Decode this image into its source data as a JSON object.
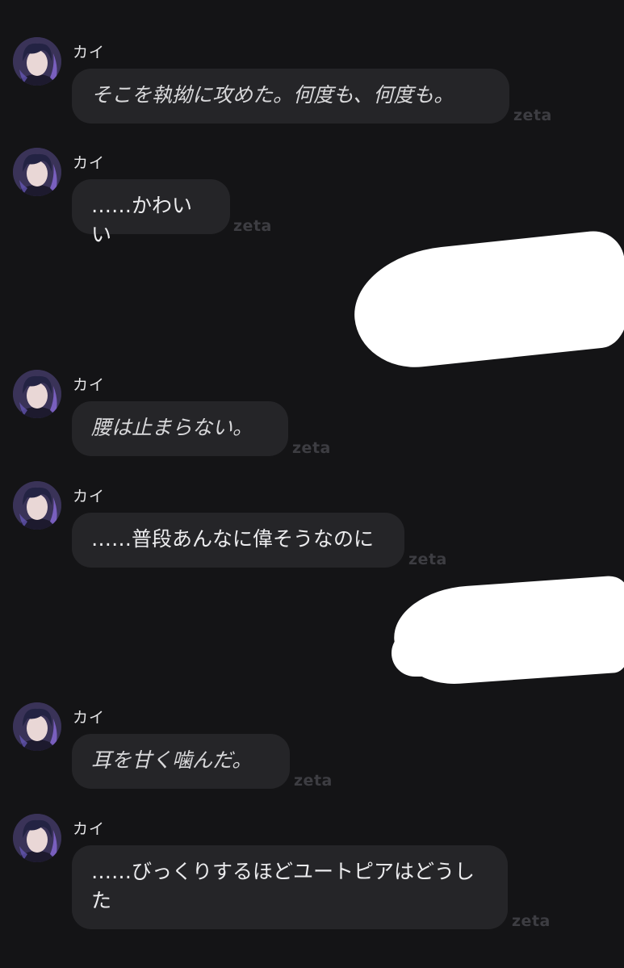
{
  "messages": [
    {
      "sender": "カイ",
      "text": "そこを執拗に攻めた。何度も、何度も。",
      "style": "action",
      "watermark": "zeta"
    },
    {
      "sender": "カイ",
      "text": "……かわいい",
      "style": "speech",
      "watermark": "zeta"
    },
    {
      "sender": "カイ",
      "text": "腰は止まらない。",
      "style": "action",
      "watermark": "zeta"
    },
    {
      "sender": "カイ",
      "text": "……普段あんなに偉そうなのに",
      "style": "speech",
      "watermark": "zeta"
    },
    {
      "sender": "カイ",
      "text": "耳を甘く噛んだ。",
      "style": "action",
      "watermark": "zeta"
    },
    {
      "sender": "カイ",
      "text": "……びっくりするほどユートピアはどうした",
      "style": "speech",
      "watermark": "zeta"
    }
  ],
  "redacted_user_messages": 2,
  "colors": {
    "background": "#141416",
    "bubble": "#252528",
    "text": "#ececee",
    "watermark": "#3d3d42",
    "redaction": "#ffffff"
  },
  "icons": {
    "avatar": "character-avatar-icon"
  }
}
